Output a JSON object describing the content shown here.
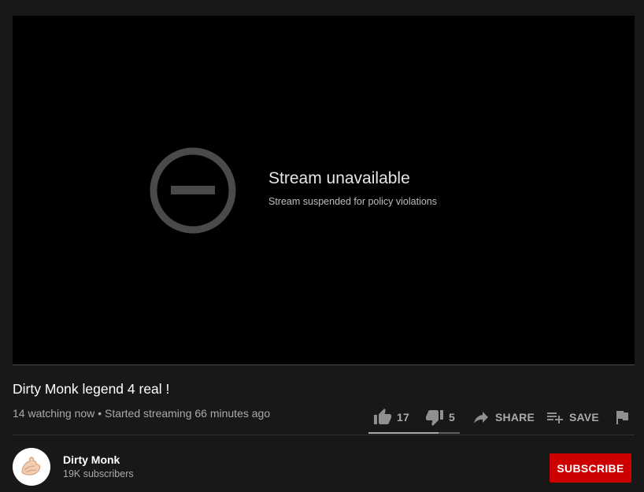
{
  "player": {
    "error_icon": "circle-minus-icon",
    "title": "Stream unavailable",
    "subtitle": "Stream suspended for policy violations"
  },
  "video": {
    "title": "Dirty Monk legend 4 real !",
    "watching": "14 watching now",
    "separator": "•",
    "started": "Started streaming 66 minutes ago"
  },
  "actions": {
    "like_icon": "thumbs-up-icon",
    "like_count": "17",
    "dislike_icon": "thumbs-down-icon",
    "dislike_count": "5",
    "share_icon": "share-arrow-icon",
    "share_label": "SHARE",
    "save_icon": "playlist-add-icon",
    "save_label": "SAVE",
    "report_icon": "flag-icon",
    "like_ratio": 0.77
  },
  "channel": {
    "name": "Dirty Monk",
    "subscribers": "19K subscribers",
    "avatar_icon": "hands-avatar-icon",
    "subscribe_label": "SUBSCRIBE"
  },
  "colors": {
    "background": "#181818",
    "player": "#000000",
    "subscribe": "#cc0000",
    "text_secondary": "#aaaaaa"
  }
}
